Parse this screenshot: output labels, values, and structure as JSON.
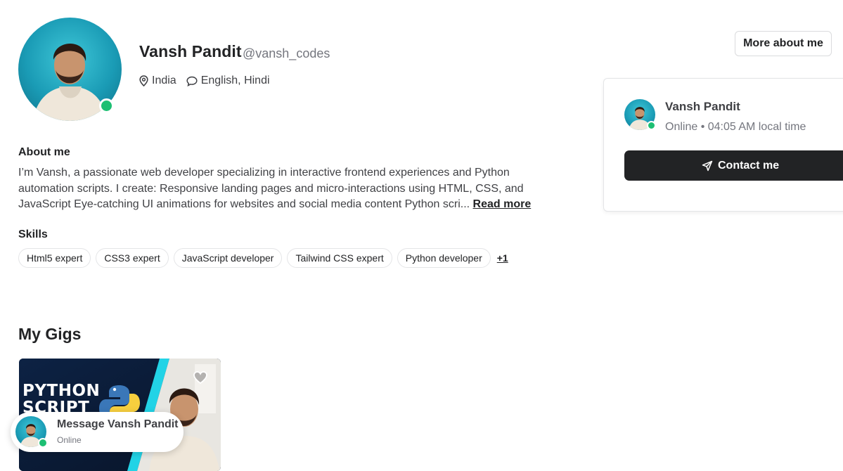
{
  "profile": {
    "name": "Vansh Pandit",
    "handle": "@vansh_codes",
    "location": "India",
    "languages": "English, Hindi",
    "online": true
  },
  "header": {
    "more_about_label": "More about me"
  },
  "about": {
    "title": "About me",
    "text": "I’m Vansh, a passionate web developer specializing in interactive frontend experiences and Python automation scripts. I create: Responsive landing pages and micro-interactions using HTML, CSS, and JavaScript Eye-catching UI animations for websites and social media content Python scri...",
    "read_more": "Read more"
  },
  "skills": {
    "title": "Skills",
    "items": [
      "Html5 expert",
      "CSS3 expert",
      "JavaScript developer",
      "Tailwind CSS expert",
      "Python developer"
    ],
    "more": "+1"
  },
  "gigs": {
    "title": "My Gigs",
    "cards": [
      {
        "image_text_line1": "PYTHON",
        "image_text_line2": "SCRIPT"
      }
    ]
  },
  "contact_card": {
    "name": "Vansh Pandit",
    "status": "Online • 04:05 AM local time",
    "button_label": "Contact me"
  },
  "message_bubble": {
    "title": "Message Vansh Pandit",
    "status": "Online"
  },
  "colors": {
    "online": "#1dbf73",
    "dark_button": "#222325",
    "avatar_bg": "#1a9bb5",
    "gig_accent": "#22d3e6"
  },
  "icons": [
    "location-pin-icon",
    "speech-bubble-icon",
    "send-icon",
    "heart-icon",
    "python-logo-icon"
  ]
}
